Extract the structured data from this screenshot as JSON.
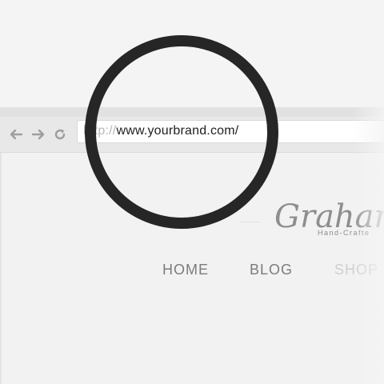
{
  "browser": {
    "nav": {
      "back_icon": "arrow-left-icon",
      "forward_icon": "arrow-right-icon",
      "reload_icon": "reload-icon"
    },
    "address_bar": {
      "protocol": "http://",
      "domain": "www.yourbrand.com/"
    }
  },
  "page": {
    "brand": {
      "name": "Graham",
      "tagline": "Hand-Crafte"
    },
    "menu": [
      {
        "label": "HOME"
      },
      {
        "label": "BLOG"
      },
      {
        "label": "SHOP"
      }
    ]
  },
  "magnifier": {
    "ring_color": "#262626"
  }
}
